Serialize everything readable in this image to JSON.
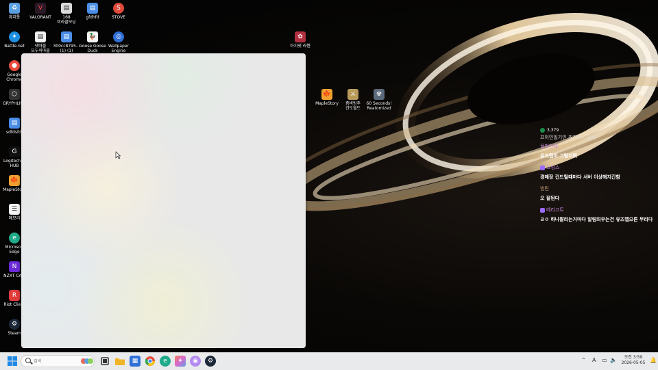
{
  "desktop": {
    "icons": [
      {
        "label": "휴지통",
        "icon": "recycle-bin-icon",
        "color": "#5aa0e0"
      },
      {
        "label": "VALORANT",
        "icon": "valorant-icon",
        "color": "#2b1a26"
      },
      {
        "label": "168\n미라클모닝",
        "icon": "document-icon",
        "color": "#dcdcdc"
      },
      {
        "label": "gfdhfd",
        "icon": "document-icon",
        "color": "#4a8ee8"
      },
      {
        "label": "STOVE",
        "icon": "stove-icon",
        "color": "#e04a3a"
      },
      {
        "label": "Battle.net",
        "icon": "battle-net-icon",
        "color": "#1e8fe0"
      },
      {
        "label": "넷마블\n모두의마블",
        "icon": "document-icon",
        "color": "#f2f2f2"
      },
      {
        "label": "300cc8795...\n(1) (1)",
        "icon": "document-icon",
        "color": "#4a8ee8"
      },
      {
        "label": "Goose Goose\nDuck",
        "icon": "goose-goose-duck-icon",
        "color": "#f3f3f3"
      },
      {
        "label": "Wallpaper\nEngine",
        "icon": "wallpaper-engine-icon",
        "color": "#2f6fd6"
      },
      {
        "label": "아치넷 라헨",
        "icon": "game-icon",
        "color": "#b03040"
      },
      {
        "label": "Google\nChrome",
        "icon": "chrome-icon",
        "color": "#e84c3d"
      },
      {
        "label": "GRYPHLINK",
        "icon": "gryphlink-icon",
        "color": "#333"
      },
      {
        "label": "sdfdsfdf",
        "icon": "document-icon",
        "color": "#4a8ee8"
      },
      {
        "label": "Logitech G\nHUB",
        "icon": "logitech-icon",
        "color": "#111"
      },
      {
        "label": "MapleStory",
        "icon": "maplestory-icon",
        "color": "#f2a030"
      },
      {
        "label": "메모리",
        "icon": "notepad-icon",
        "color": "#f4f4f4"
      },
      {
        "label": "Microsoft\nEdge",
        "icon": "edge-icon",
        "color": "#1faa8a"
      },
      {
        "label": "NZXT CAM",
        "icon": "nzxt-icon",
        "color": "#6a2bd6"
      },
      {
        "label": "Riot Client",
        "icon": "riot-icon",
        "color": "#e03a3a"
      },
      {
        "label": "Steam",
        "icon": "steam-icon",
        "color": "#1b2838"
      },
      {
        "label": "MapleStory",
        "icon": "maplestory-icon",
        "color": "#f2a030"
      },
      {
        "label": "좀비방주\n건도월드",
        "icon": "game-icon",
        "color": "#b89a5a"
      },
      {
        "label": "60 Seconds!\nReatomized",
        "icon": "game-icon",
        "color": "#5a6a7a"
      }
    ]
  },
  "chat": {
    "viewer_count": "3,379",
    "cut_message": "프이인일기인 추가하시 말씨",
    "messages": [
      {
        "user": "꿀빌인재",
        "user_color": "#c98bd8",
        "badge": false,
        "text": "유즈맵이 그렇지뭐"
      },
      {
        "user": "크빙스",
        "user_color": "#c98bd8",
        "badge": true,
        "text": "경매장 건드릴때마다 서버 이상해지긴함"
      },
      {
        "user": "빙린",
        "user_color": "#d8a57a",
        "badge": false,
        "text": "오 잘된다"
      },
      {
        "user": "베리고트",
        "user_color": "#c98bd8",
        "badge": true,
        "text": "ㄹㅇ 하나팔리는거마다 알림띄우는건 유즈맵으른 무리다"
      }
    ]
  },
  "taskbar": {
    "search_placeholder": "검색",
    "apps": [
      {
        "name": "task-view",
        "icon": "task-view-icon",
        "color": "#333"
      },
      {
        "name": "file-explorer",
        "icon": "folder-icon",
        "color": "#f0b429"
      },
      {
        "name": "store",
        "icon": "store-icon",
        "color": "#2f6fd6"
      },
      {
        "name": "chrome",
        "icon": "chrome-icon",
        "color": "#e84c3d"
      },
      {
        "name": "edge",
        "icon": "edge-icon",
        "color": "#1faa8a"
      },
      {
        "name": "colorful-app",
        "icon": "app-icon",
        "color": "#d86ad0"
      },
      {
        "name": "purple-app",
        "icon": "app-icon",
        "color": "#b48bf0"
      },
      {
        "name": "steam",
        "icon": "steam-icon",
        "color": "#1b2838"
      }
    ],
    "tray": {
      "time": "오전 3:59",
      "date": "2026-05-05"
    }
  }
}
